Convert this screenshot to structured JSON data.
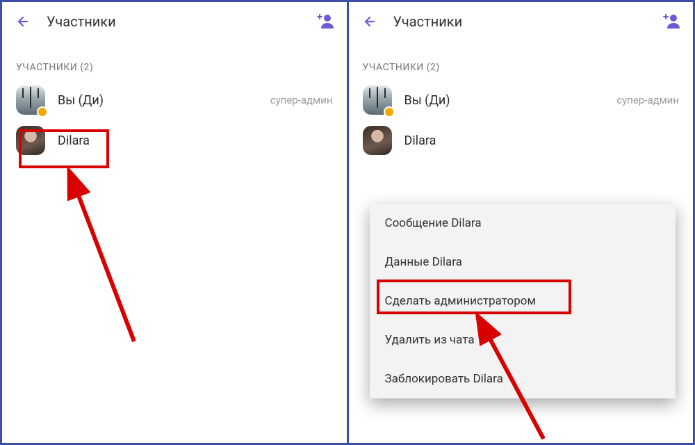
{
  "colors": {
    "accent": "#6a5ad8",
    "highlight": "#d90000",
    "frame": "#3b4ea8"
  },
  "left": {
    "header": {
      "title": "Участники"
    },
    "section_label": "УЧАСТНИКИ (2)",
    "members": [
      {
        "name": "Вы (Ди)",
        "role": "супер-админ"
      },
      {
        "name": "Dilara",
        "role": ""
      }
    ]
  },
  "right": {
    "header": {
      "title": "Участники"
    },
    "section_label": "УЧАСТНИКИ (2)",
    "members": [
      {
        "name": "Вы (Ди)",
        "role": "супер-админ"
      },
      {
        "name": "Dilara",
        "role": ""
      }
    ],
    "menu": {
      "items": [
        "Сообщение Dilara",
        "Данные Dilara",
        "Сделать администратором",
        "Удалить из чата",
        "Заблокировать Dilara"
      ]
    }
  }
}
